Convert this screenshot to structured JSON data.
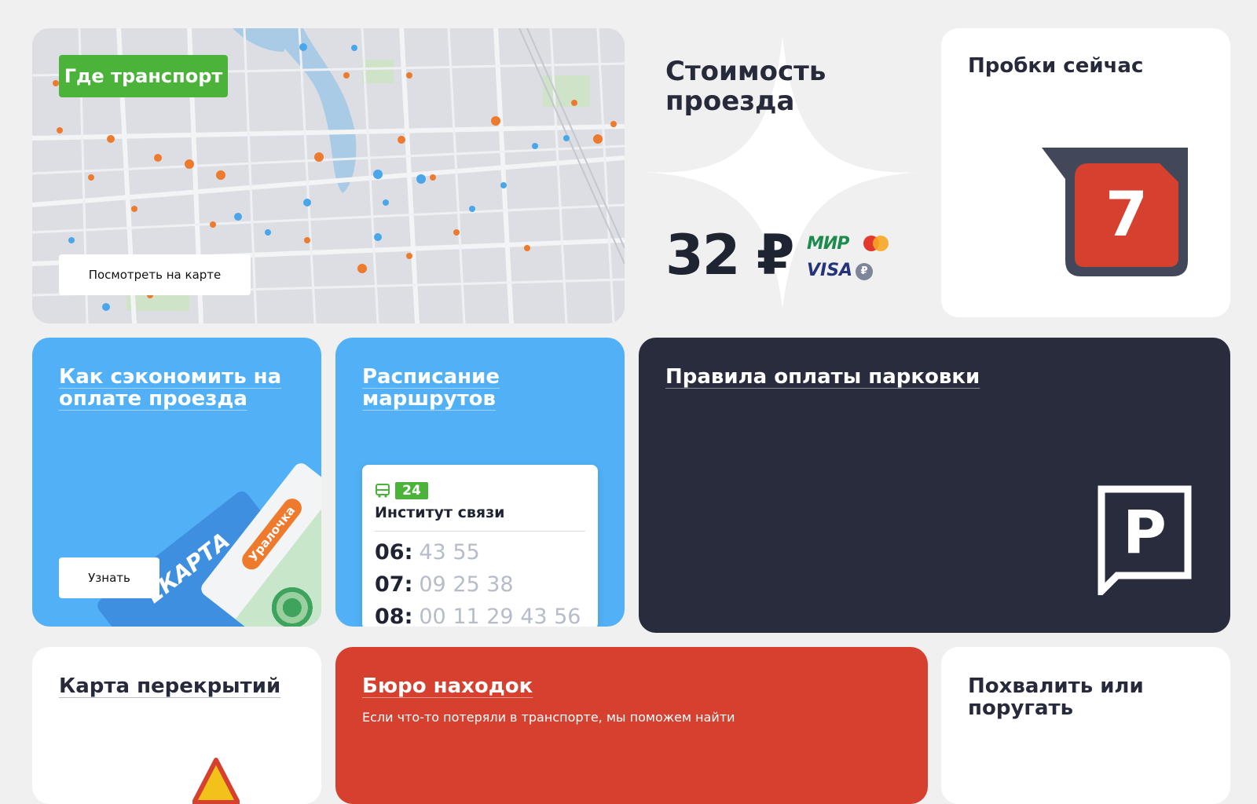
{
  "map_card": {
    "badge": "Где транспорт",
    "button": "Посмотреть на карте"
  },
  "fare_card": {
    "title_line1": "Стоимость",
    "title_line2": "проезда",
    "price": "32 ₽",
    "payment_icons": [
      "mir-icon",
      "mastercard-icon",
      "visa-icon",
      "ruble-coin-icon"
    ]
  },
  "traffic_card": {
    "title": "Пробки сейчас",
    "level": "7"
  },
  "save_card": {
    "title_line1": "Как сэкономить на",
    "title_line2": "оплате проезда",
    "button": "Узнать",
    "card_brand": "ЕКАРТА",
    "card_name": "Уралочка"
  },
  "schedule_card": {
    "title": "Расписание маршрутов",
    "route": "24",
    "stop": "Институт связи",
    "rows": [
      {
        "hour": "06:",
        "minutes": "43  55"
      },
      {
        "hour": "07:",
        "minutes": "09  25  38"
      },
      {
        "hour": "08:",
        "minutes": "00  11  29  43  56"
      }
    ]
  },
  "parking_card": {
    "title": "Правила оплаты парковки",
    "icon_letter": "P"
  },
  "closures_card": {
    "title": "Карта перекрытий"
  },
  "lost_card": {
    "title": "Бюро находок",
    "subtitle": "Если что-то потеряли в транспорте, мы поможем найти"
  },
  "feedback_card": {
    "title_line1": "Похвалить или",
    "title_line2": "поругать"
  },
  "colors": {
    "green": "#4bb33a",
    "blue": "#52b1f6",
    "dark": "#292c3c",
    "red": "#d6402f"
  }
}
